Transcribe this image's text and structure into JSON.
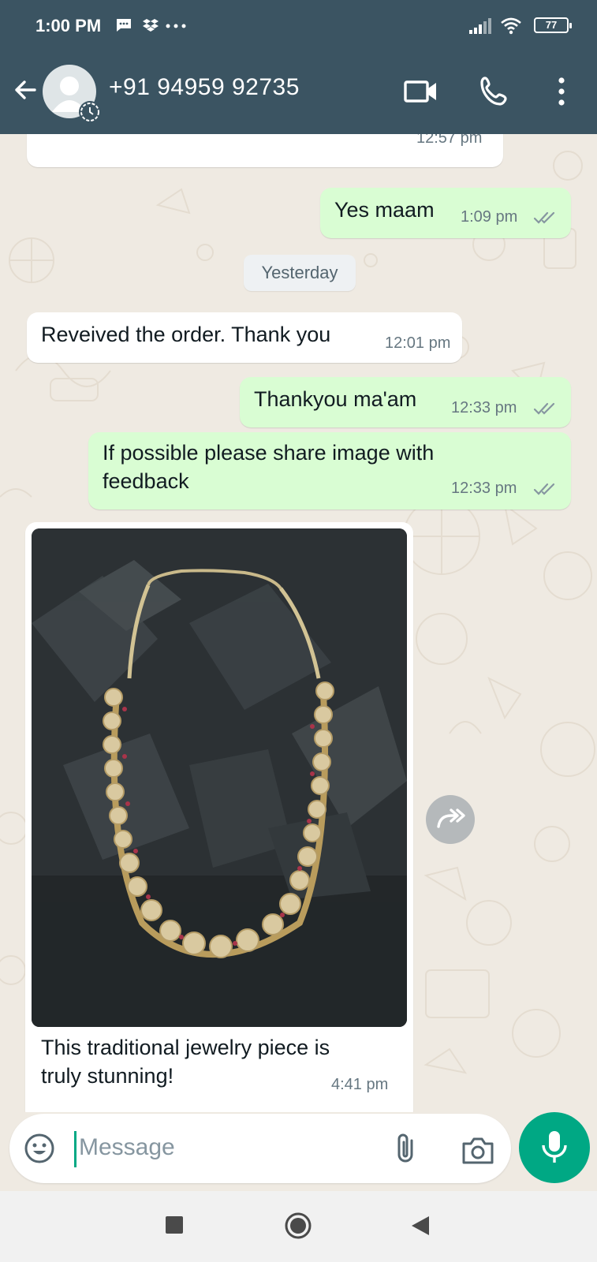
{
  "status_bar": {
    "time": "1:00 PM",
    "battery": "77",
    "icons": [
      "message-icon",
      "dropbox-icon",
      "more-dots-icon",
      "signal-icon",
      "wifi-icon",
      "battery-icon"
    ]
  },
  "header": {
    "contact_name": "+91 94959 92735",
    "icons": [
      "back-arrow-icon",
      "avatar-icon",
      "video-call-icon",
      "voice-call-icon",
      "overflow-menu-icon"
    ]
  },
  "messages": {
    "m0": {
      "time": "12:57 pm"
    },
    "m1": {
      "text": "Yes maam",
      "time": "1:09 pm"
    },
    "day": "Yesterday",
    "m2": {
      "text": "Reveived the order. Thank you",
      "time": "12:01 pm"
    },
    "m3": {
      "text": "Thankyou ma'am",
      "time": "12:33 pm"
    },
    "m4": {
      "line1": "If possible please share image with",
      "line2": "feedback",
      "time": "12:33 pm"
    },
    "m5": {
      "line1": "This traditional jewelry piece is",
      "line2": "truly stunning!",
      "time": "4:41 pm",
      "image": "gold necklace photo"
    }
  },
  "composer": {
    "placeholder": "Message",
    "icons": [
      "emoji-icon",
      "attach-icon",
      "camera-icon",
      "mic-icon"
    ]
  },
  "colors": {
    "header": "#3b5462",
    "outgoing": "#d9fdd3",
    "incoming": "#ffffff",
    "accent": "#00a884",
    "ticks": "#8696a0"
  }
}
